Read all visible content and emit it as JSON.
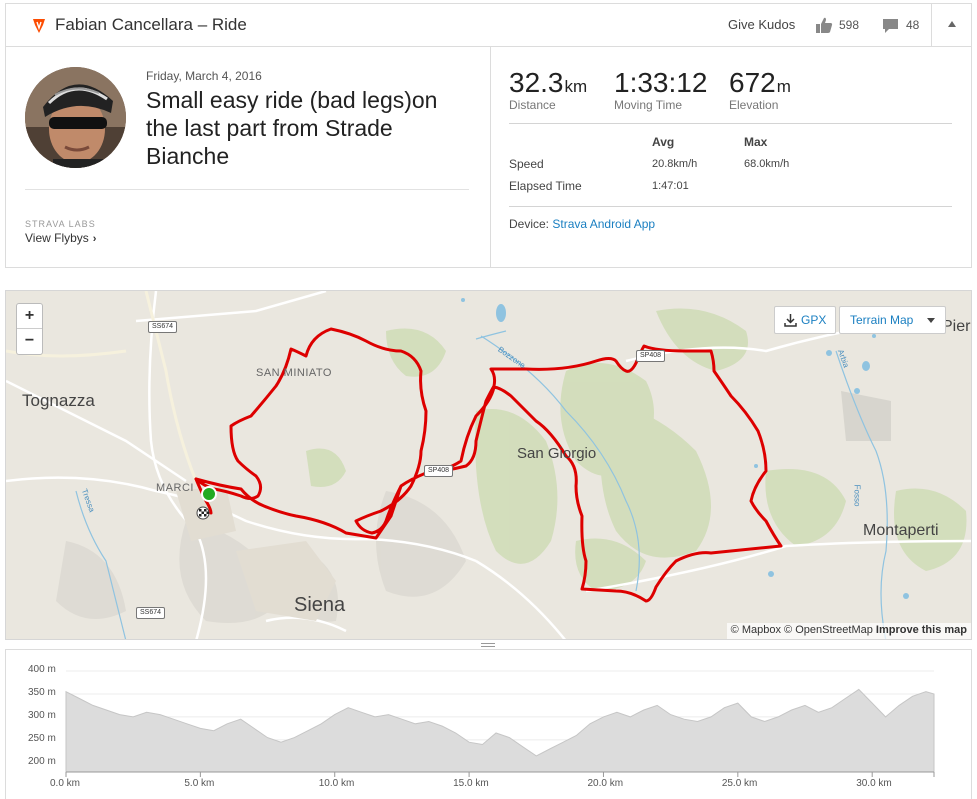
{
  "header": {
    "title": "Fabian Cancellara – Ride",
    "kudos_label": "Give Kudos",
    "kudos_count": "598",
    "comment_count": "48",
    "brand_color": "#fc4c02"
  },
  "activity": {
    "date": "Friday, March 4, 2016",
    "title": "Small easy ride (bad legs)on the last part from Strade Bianche",
    "labs_label": "STRAVA LABS",
    "flybys_label": "View Flybys"
  },
  "stats": {
    "distance": {
      "value": "32.3",
      "unit": "km",
      "label": "Distance"
    },
    "moving_time": {
      "value": "1:33:12",
      "label": "Moving Time"
    },
    "elevation": {
      "value": "672",
      "unit": "m",
      "label": "Elevation"
    },
    "table": {
      "col_avg": "Avg",
      "col_max": "Max",
      "speed_label": "Speed",
      "speed_avg": "20.8km/h",
      "speed_max": "68.0km/h",
      "elapsed_label": "Elapsed Time",
      "elapsed_avg": "1:47:01"
    },
    "device_label": "Device:",
    "device_value": "Strava Android App"
  },
  "map": {
    "zoom_in": "+",
    "zoom_out": "−",
    "gpx_label": "GPX",
    "terrain_label": "Terrain Map",
    "places": {
      "tognazza": "Tognazza",
      "san_miniato": "SAN MINIATO",
      "san_giorgio": "San Giorgio",
      "montaperti": "Montaperti",
      "siena": "Siena",
      "marciano": "MARCI",
      "pieve": "Pier",
      "bozzone": "Bozzone",
      "arbia": "Arbia",
      "tressa": "Tressa",
      "fosso": "Fosso"
    },
    "roads": {
      "ss674_top": "SS674",
      "ss674_bottom": "SS674",
      "sp408_mid": "SP408",
      "sp408_top": "SP408"
    },
    "attribution": {
      "mapbox": "© Mapbox",
      "osm": "© OpenStreetMap",
      "improve": "Improve this map"
    },
    "route_color": "#dd0000",
    "start_color": "#22aa22"
  },
  "elevation_profile": {
    "y_ticks": [
      "400 m",
      "350 m",
      "300 m",
      "250 m",
      "200 m"
    ],
    "x_ticks": [
      "0.0 km",
      "5.0 km",
      "10.0 km",
      "15.0 km",
      "20.0 km",
      "25.0 km",
      "30.0 km"
    ]
  },
  "chart_data": {
    "type": "area",
    "xlabel": "",
    "ylabel": "",
    "xlim": [
      0,
      32.3
    ],
    "ylim": [
      180,
      400
    ],
    "x": [
      0,
      0.5,
      1,
      1.5,
      2,
      2.5,
      3,
      3.5,
      4,
      4.5,
      5,
      5.5,
      6,
      6.5,
      7,
      7.5,
      8,
      8.5,
      9,
      9.5,
      10,
      10.5,
      11,
      11.5,
      12,
      12.5,
      13,
      13.5,
      14,
      14.5,
      15,
      15.5,
      16,
      16.5,
      17,
      17.5,
      18,
      18.5,
      19,
      19.5,
      20,
      20.5,
      21,
      21.5,
      22,
      22.5,
      23,
      23.5,
      24,
      24.5,
      25,
      25.5,
      26,
      26.5,
      27,
      27.5,
      28,
      28.5,
      29,
      29.5,
      30,
      30.5,
      31,
      31.5,
      32,
      32.3
    ],
    "series": [
      {
        "values": [
          355,
          340,
          325,
          315,
          305,
          300,
          310,
          305,
          295,
          285,
          275,
          270,
          285,
          295,
          275,
          255,
          245,
          255,
          270,
          285,
          305,
          320,
          310,
          300,
          305,
          295,
          285,
          290,
          280,
          265,
          245,
          240,
          265,
          255,
          235,
          215,
          230,
          245,
          260,
          285,
          300,
          310,
          300,
          315,
          325,
          305,
          295,
          290,
          300,
          320,
          330,
          300,
          290,
          300,
          315,
          325,
          310,
          320,
          340,
          360,
          330,
          300,
          325,
          345,
          355,
          350
        ]
      }
    ]
  }
}
